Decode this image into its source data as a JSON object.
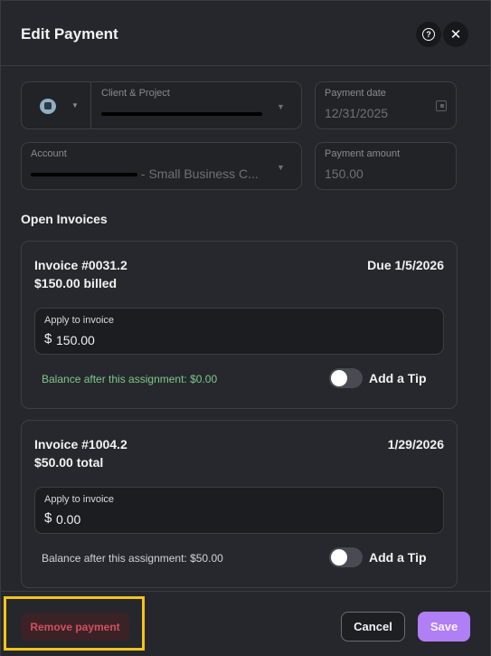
{
  "dialog": {
    "title": "Edit Payment",
    "help_icon": "question-circle-icon",
    "close_icon": "close-icon"
  },
  "form": {
    "client_project": {
      "label": "Client & Project",
      "value_visible_tail": "",
      "icon": "briefcase-icon"
    },
    "payment_date": {
      "label": "Payment date",
      "value": "12/31/2025",
      "icon": "calendar-icon"
    },
    "account": {
      "label": "Account",
      "value_visible_tail": "- Small Business C..."
    },
    "payment_amount": {
      "label": "Payment amount",
      "value": "150.00"
    }
  },
  "invoices_section": {
    "title": "Open Invoices",
    "invoices": [
      {
        "number": "Invoice #0031.2",
        "due": "Due 1/5/2026",
        "amount_text": "$150.00 billed",
        "apply_label": "Apply to invoice",
        "currency": "$",
        "apply_value": "150.00",
        "balance_text": "Balance after this assignment: $0.00",
        "tip_label": "Add a Tip",
        "tip_enabled": false
      },
      {
        "number": "Invoice #1004.2",
        "due": "1/29/2026",
        "amount_text": "$50.00 total",
        "apply_label": "Apply to invoice",
        "currency": "$",
        "apply_value": "0.00",
        "balance_text": "Balance after this assignment: $50.00",
        "tip_label": "Add a Tip",
        "tip_enabled": false
      }
    ]
  },
  "footer": {
    "remove_label": "Remove payment",
    "cancel_label": "Cancel",
    "save_label": "Save"
  },
  "colors": {
    "accent": "#b07ef5",
    "danger": "#d2515f",
    "success_text": "#7ec88a",
    "highlight": "#f4c41a"
  }
}
